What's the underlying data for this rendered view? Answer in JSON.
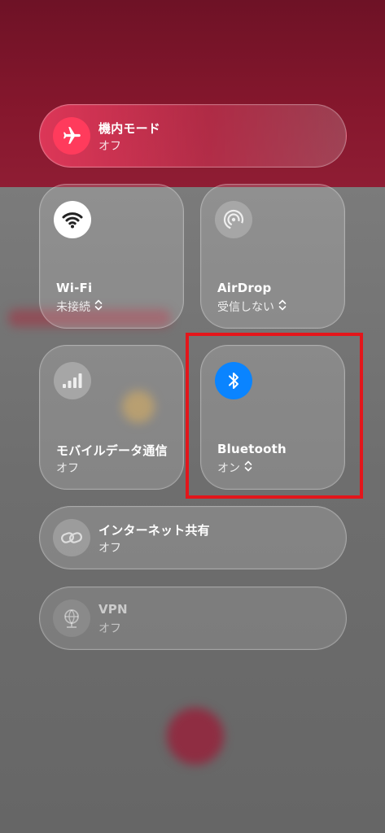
{
  "airplane": {
    "title": "機内モード",
    "status": "オフ",
    "icon": "airplane-icon",
    "color": "#ff3b5c"
  },
  "wifi": {
    "title": "Wi-Fi",
    "status": "未接続",
    "icon": "wifi-icon"
  },
  "airdrop": {
    "title": "AirDrop",
    "status": "受信しない",
    "icon": "airdrop-icon"
  },
  "cellular": {
    "title": "モバイルデータ通信",
    "status": "オフ",
    "icon": "cellular-bars-icon"
  },
  "bluetooth": {
    "title": "Bluetooth",
    "status": "オン",
    "icon": "bluetooth-icon",
    "color": "#0a84ff"
  },
  "hotspot": {
    "title": "インターネット共有",
    "status": "オフ",
    "icon": "hotspot-link-icon"
  },
  "vpn": {
    "title": "VPN",
    "status": "オフ",
    "icon": "vpn-globe-icon"
  },
  "highlight_color": "#e3161b"
}
